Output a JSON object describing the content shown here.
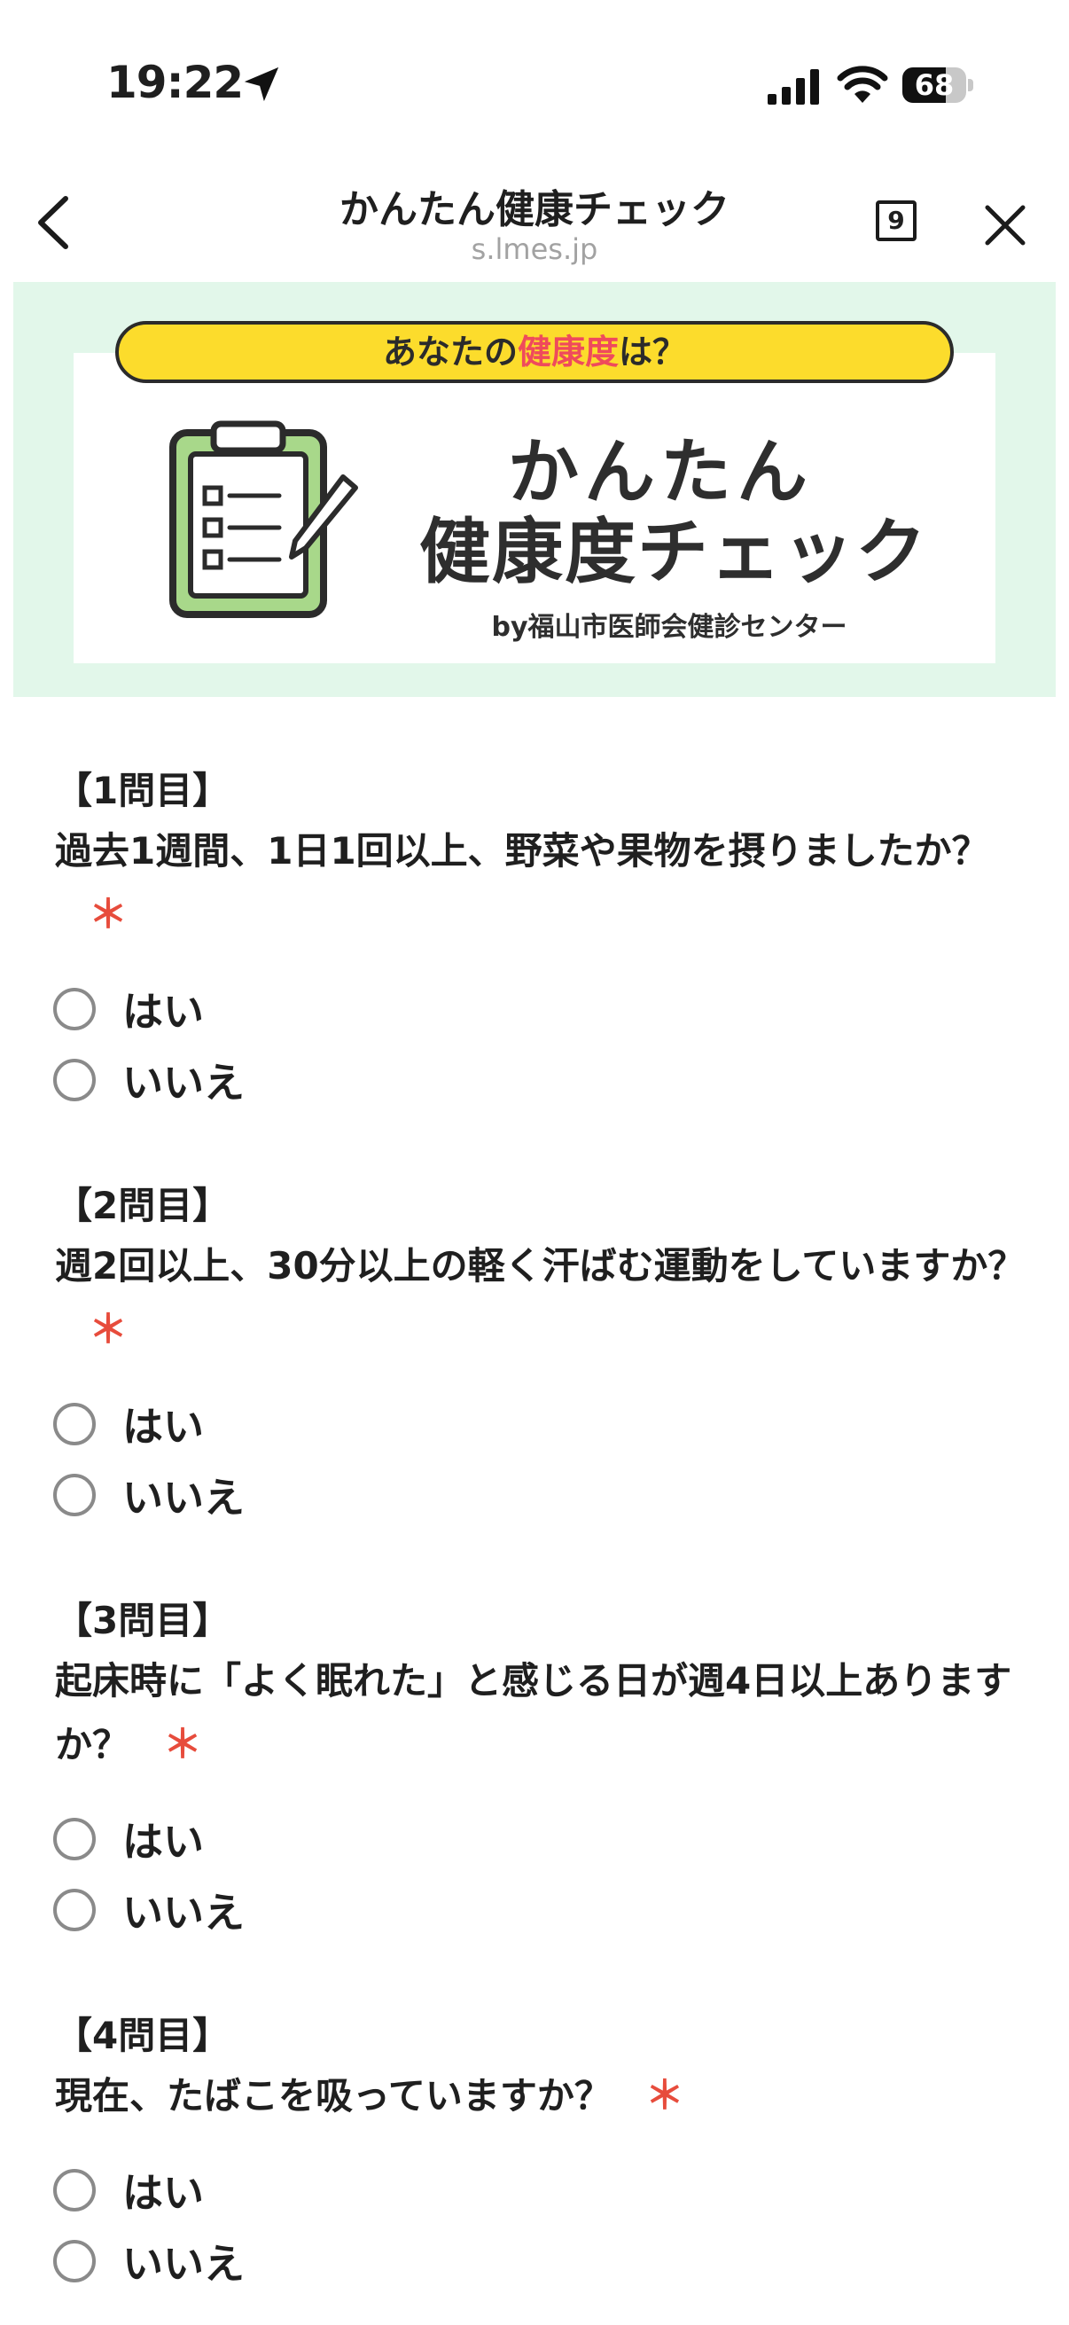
{
  "status": {
    "time": "19:22",
    "battery": "68",
    "battery_level": 0.68
  },
  "nav": {
    "title": "かんたん健康チェック",
    "domain": "s.lmes.jp",
    "tab_count": "9"
  },
  "banner": {
    "pill_prefix": "あなたの",
    "pill_highlight": "健康度",
    "pill_suffix": "は？",
    "title_line1": "かんたん",
    "title_line2": "健康度チェック",
    "byline": "by福山市医師会健診センター"
  },
  "required_mark": "＊",
  "questions": [
    {
      "number": "【1問目】",
      "text": "過去1週間、1日1回以上、野菜や果物を摂りましたか？",
      "options": [
        "はい",
        "いいえ"
      ]
    },
    {
      "number": "【2問目】",
      "text": "週2回以上、30分以上の軽く汗ばむ運動をしていますか？",
      "options": [
        "はい",
        "いいえ"
      ]
    },
    {
      "number": "【3問目】",
      "text": "起床時に「よく眠れた」と感じる日が週4日以上ありますか？",
      "options": [
        "はい",
        "いいえ"
      ]
    },
    {
      "number": "【4問目】",
      "text": "現在、たばこを吸っていますか？",
      "options": [
        "はい",
        "いいえ"
      ]
    }
  ]
}
